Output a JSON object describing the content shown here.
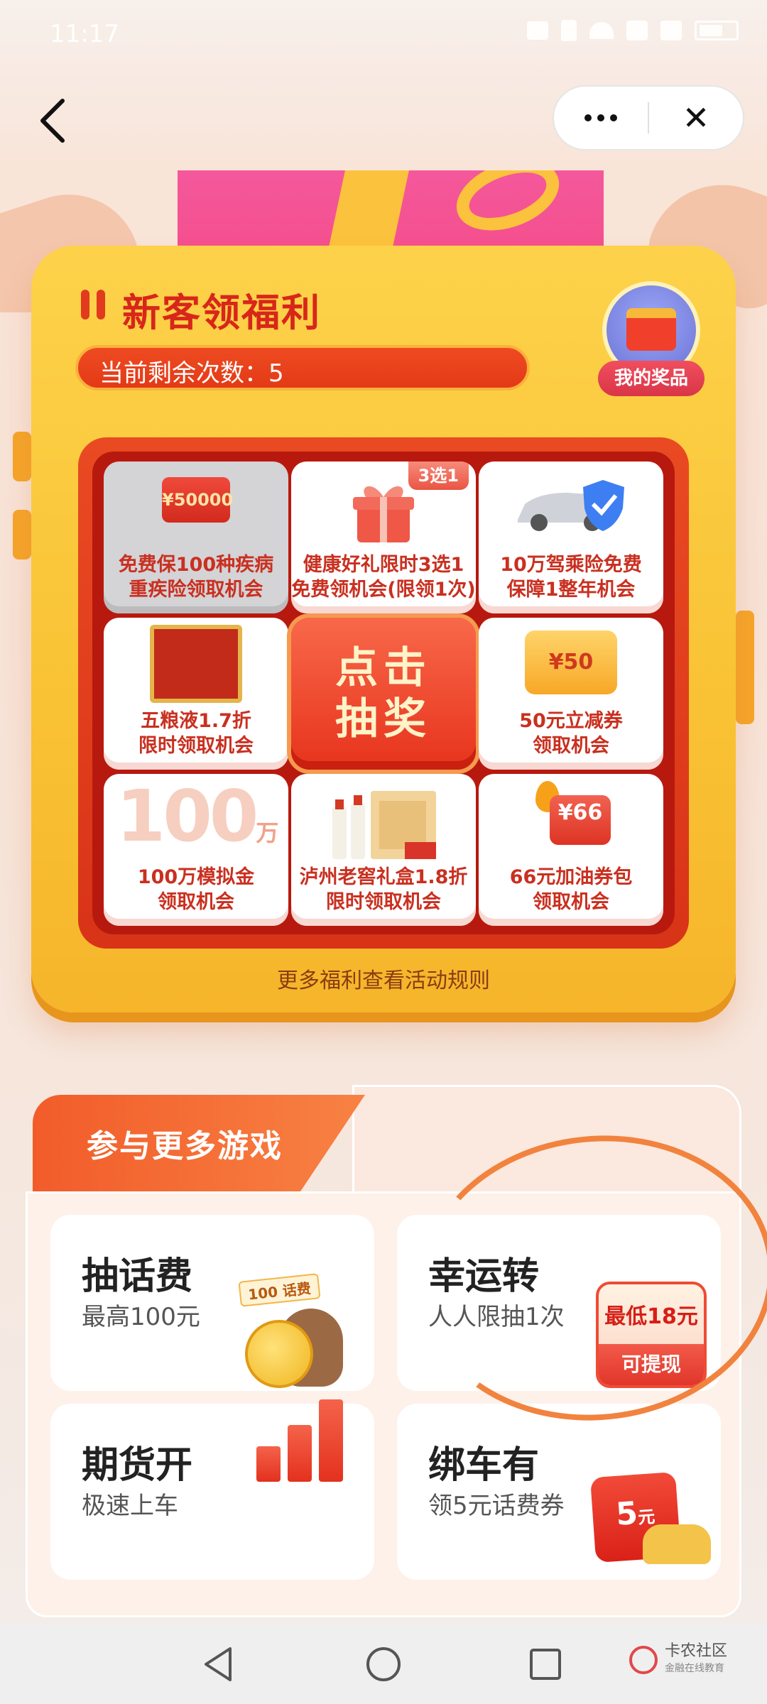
{
  "status_bar": {
    "time": "11:17"
  },
  "nav": {
    "more_icon": "more-icon",
    "close_label": "✕"
  },
  "lottery": {
    "title": "新客领福利",
    "remaining_label": "当前剩余次数：5",
    "my_prizes_label": "我的奖品",
    "draw_button_label": "点击抽奖",
    "rules_link": "更多福利查看活动规则",
    "cells": [
      {
        "label_line1": "免费保100种疾病",
        "label_line2": "重疾险领取机会",
        "icon": "money-envelope-icon",
        "icon_text": "¥50000",
        "active": true
      },
      {
        "label_line1": "健康好礼限时3选1",
        "label_line2": "免费领机会(限领1次)",
        "icon": "gift-box-icon",
        "tag": "3选1"
      },
      {
        "label_line1": "10万驾乘险免费",
        "label_line2": "保障1整年机会",
        "icon": "car-shield-icon"
      },
      {
        "label_line1": "五粮液1.7折",
        "label_line2": "限时领取机会",
        "icon": "liquor-box-icon"
      },
      {
        "label_line1": "50元立减券",
        "label_line2": "领取机会",
        "icon": "coupon-icon",
        "icon_text": "¥50"
      },
      {
        "label_line1": "100万模拟金",
        "label_line2": "领取机会",
        "icon": "100-wan-icon",
        "icon_text": "100",
        "icon_unit": "万"
      },
      {
        "label_line1": "泸州老窖礼盒1.8折",
        "label_line2": "限时领取机会",
        "icon": "wine-gift-icon"
      },
      {
        "label_line1": "66元加油券包",
        "label_line2": "领取机会",
        "icon": "fuel-coupon-icon",
        "icon_text": "¥66"
      }
    ]
  },
  "games": {
    "section_title": "参与更多游戏",
    "cards": [
      {
        "title": "抽话费",
        "subtitle": "最高100元",
        "art": "otter-coin-icon",
        "art_text": "100 话费"
      },
      {
        "title": "幸运转",
        "subtitle": "人人限抽1次",
        "badge_top": "最低18元",
        "badge_bottom": "可提现"
      },
      {
        "title": "期货开",
        "subtitle": "极速上车",
        "art": "bar-chart-icon"
      },
      {
        "title": "绑车有",
        "subtitle": "领5元话费券",
        "badge": "5",
        "badge_unit": "元",
        "art": "car-icon"
      }
    ]
  },
  "system_nav": {
    "watermark_title": "卡农社区",
    "watermark_sub": "金融在线教育"
  },
  "colors": {
    "accent_red": "#d8261a",
    "card_yellow": "#fdd24a",
    "orange_circle": "#f1833e"
  }
}
